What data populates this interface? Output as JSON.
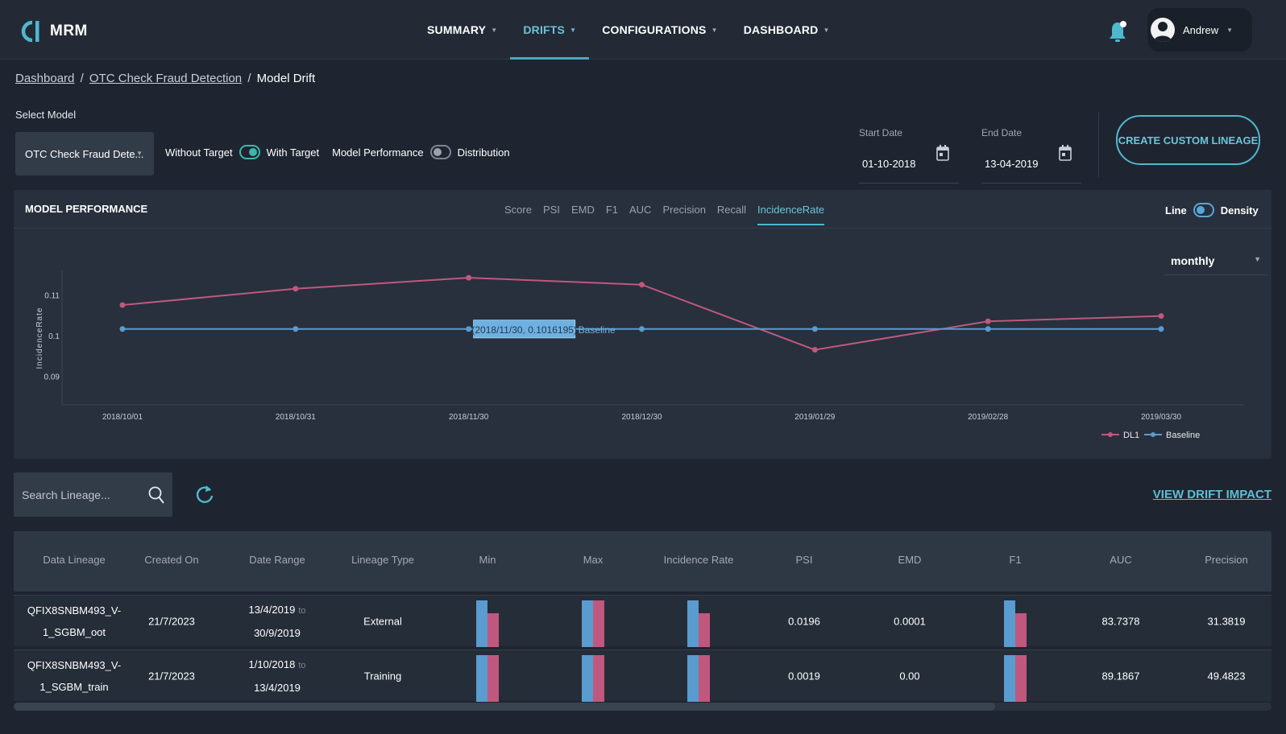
{
  "app": {
    "name": "MRM"
  },
  "nav": {
    "items": [
      {
        "label": "SUMMARY",
        "active": false
      },
      {
        "label": "DRIFTS",
        "active": true
      },
      {
        "label": "CONFIGURATIONS",
        "active": false
      },
      {
        "label": "DASHBOARD",
        "active": false
      }
    ],
    "user_name": "Andrew"
  },
  "breadcrumb": {
    "items": [
      "Dashboard",
      "OTC Check Fraud Detection"
    ],
    "current": "Model Drift",
    "separator": "/"
  },
  "controls": {
    "select_label": "Select Model",
    "model_value": "OTC Check Fraud Dete...",
    "without_target": "Without Target",
    "with_target": "With Target",
    "with_target_on": true,
    "model_performance": "Model Performance",
    "distribution": "Distribution",
    "distribution_on": false,
    "start_date_label": "Start Date",
    "start_date": "01-10-2018",
    "end_date_label": "End Date",
    "end_date": "13-04-2019",
    "create_button": "CREATE CUSTOM LINEAGE"
  },
  "panel": {
    "title": "MODEL PERFORMANCE",
    "tabs": [
      "Score",
      "PSI",
      "EMD",
      "F1",
      "AUC",
      "Precision",
      "Recall",
      "IncidenceRate"
    ],
    "active_tab": "IncidenceRate",
    "mode_line": "Line",
    "mode_density": "Density",
    "frequency": "monthly"
  },
  "chart_data": {
    "type": "line",
    "x": [
      "2018/10/01",
      "2018/10/31",
      "2018/11/30",
      "2018/12/30",
      "2019/01/29",
      "2019/02/28",
      "2019/03/30"
    ],
    "series": [
      {
        "name": "DL1",
        "color": "#c0587e",
        "values": [
          0.1075,
          0.1115,
          0.1142,
          0.1125,
          0.0965,
          0.1035,
          0.1048
        ]
      },
      {
        "name": "Baseline",
        "color": "#5a9bd0",
        "values": [
          0.1016195,
          0.1016195,
          0.1016195,
          0.1016195,
          0.1016195,
          0.1016195,
          0.1016195
        ]
      }
    ],
    "ylabel": "IncidenceRate",
    "yticks": [
      "0.11",
      "0.1",
      "0.09"
    ],
    "ylim": [
      0.083,
      0.116
    ],
    "tooltip": {
      "text": "(2018/11/30, 0.1016195)",
      "series": "Baseline"
    },
    "legend_position": "bottom-right"
  },
  "search": {
    "placeholder": "Search Lineage..."
  },
  "view_drift_impact": "VIEW DRIFT IMPACT",
  "table": {
    "columns": [
      "Data Lineage",
      "Created On",
      "Date Range",
      "Lineage Type",
      "Min",
      "Max",
      "Incidence Rate",
      "PSI",
      "EMD",
      "F1",
      "AUC",
      "Precision"
    ],
    "range_separator": "to",
    "rows": [
      {
        "lineage_1": "QFIX8SNBM493_V-",
        "lineage_2": "1_SGBM_oot",
        "created": "21/7/2023",
        "range_start": "13/4/2019",
        "range_end": "30/9/2019",
        "type": "External",
        "psi": "0.0196",
        "emd": "0.0001",
        "auc": "83.7378",
        "precision": "31.3819",
        "bars": {
          "min": [
            1.0,
            0.72
          ],
          "max": [
            1.0,
            1.0
          ],
          "incidence": [
            1.0,
            0.72
          ],
          "f1": [
            1.0,
            0.72
          ]
        }
      },
      {
        "lineage_1": "QFIX8SNBM493_V-",
        "lineage_2": "1_SGBM_train",
        "created": "21/7/2023",
        "range_start": "1/10/2018",
        "range_end": "13/4/2019",
        "type": "Training",
        "psi": "0.0019",
        "emd": "0.00",
        "auc": "89.1867",
        "precision": "49.4823",
        "bars": {
          "min": [
            1.0,
            1.0
          ],
          "max": [
            1.0,
            1.0
          ],
          "incidence": [
            1.0,
            1.0
          ],
          "f1": [
            1.0,
            1.0
          ]
        }
      }
    ]
  },
  "colors": {
    "accent": "#4eb8cf",
    "bar_blue": "#5a9bd0",
    "bar_pink": "#c0587e",
    "background": "#1e2530"
  },
  "scroll_position": 0.78
}
